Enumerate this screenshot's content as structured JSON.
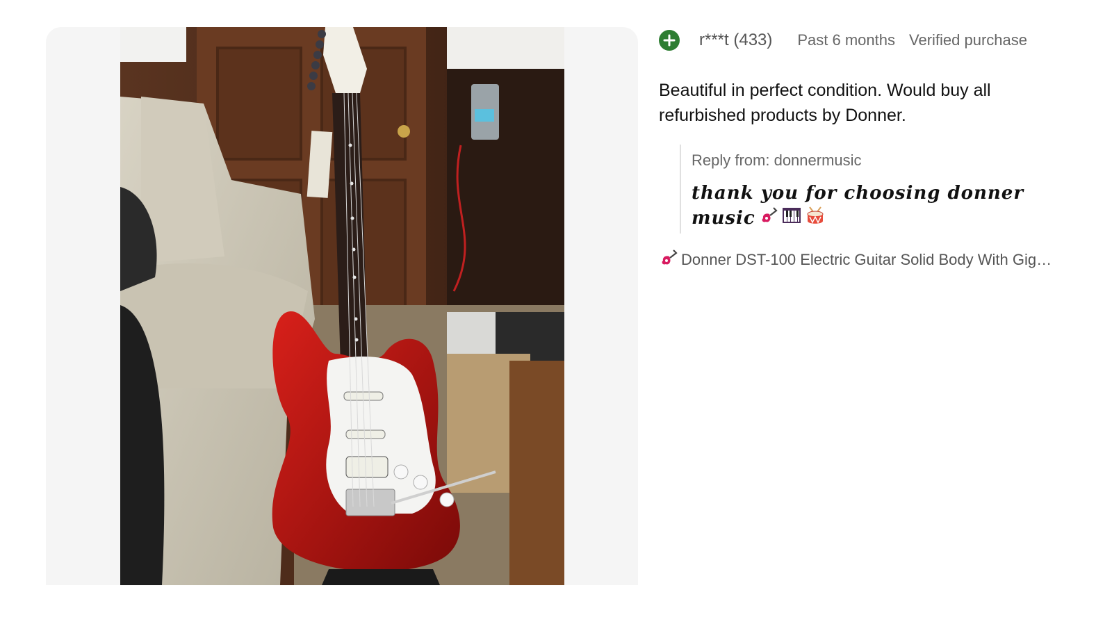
{
  "review": {
    "reviewer": "r***t (433)",
    "date": "Past 6 months",
    "verified": "Verified purchase",
    "text": "Beautiful in perfect condition. Would buy all refurbished products by Donner.",
    "reply_label": "Reply from: donnermusic",
    "reply_text": "thank you for choosing donner music",
    "product_link": "Donner DST-100 Electric Guitar Solid Body With Gig…"
  },
  "icons": {
    "badge": "plus-circle-icon",
    "reply_emoji": [
      "guitar-icon",
      "piano-keys-icon",
      "drum-icon"
    ],
    "product": "guitar-icon"
  },
  "colors": {
    "badge_green": "#2e7d32",
    "panel_bg": "#f5f5f5",
    "guitar_red": "#b0120e"
  }
}
